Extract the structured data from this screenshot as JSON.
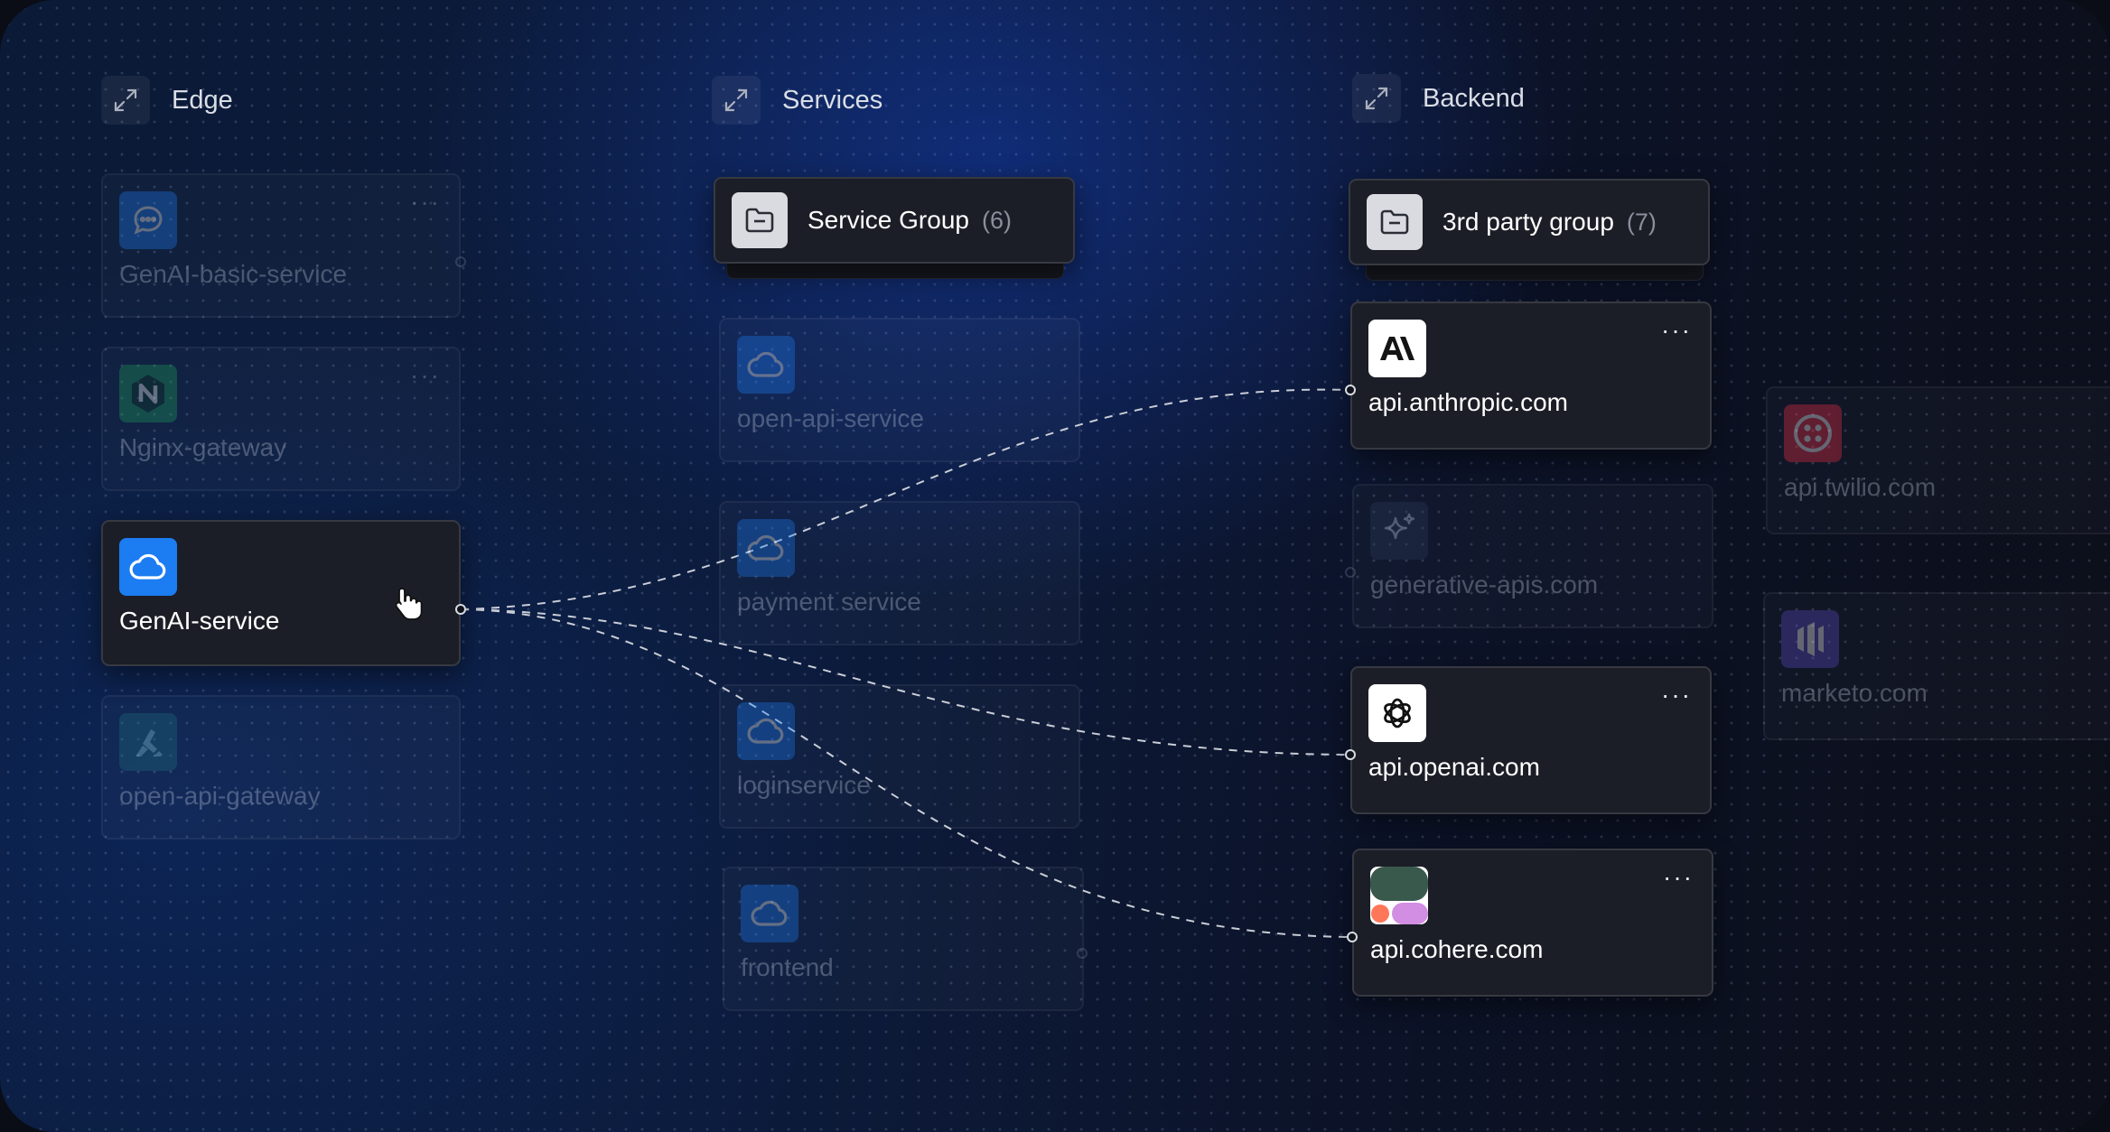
{
  "headers": {
    "edge": "Edge",
    "services": "Services",
    "backend": "Backend"
  },
  "edge": {
    "genai_basic": {
      "label": "GenAI-basic-service",
      "menu": "···",
      "icon": "chat-bubble-icon"
    },
    "nginx": {
      "label": "Nginx-gateway",
      "menu": "···",
      "icon": "nginx-icon"
    },
    "genai": {
      "label": "GenAI-service",
      "icon": "cloud-icon",
      "accent": "#1c7cf2"
    },
    "open_api_gateway": {
      "label": "open-api-gateway",
      "icon": "kong-icon"
    }
  },
  "services": {
    "group": {
      "name": "Service Group",
      "count": "(6)",
      "icon": "folder-icon"
    },
    "items": [
      {
        "label": "open-api-service",
        "icon": "cloud-icon"
      },
      {
        "label": "payment service",
        "icon": "cloud-icon"
      },
      {
        "label": "loginservice",
        "icon": "cloud-icon"
      },
      {
        "label": "frontend",
        "icon": "cloud-icon"
      }
    ]
  },
  "backend": {
    "group": {
      "name": "3rd party group",
      "count": "(7)",
      "icon": "folder-icon"
    },
    "anthropic": {
      "label": "api.anthropic.com",
      "menu": "···",
      "icon": "anthropic-icon"
    },
    "generative": {
      "label": "generative-apis.com",
      "icon": "sparkle-icon"
    },
    "openai": {
      "label": "api.openai.com",
      "menu": "···",
      "icon": "openai-icon"
    },
    "cohere": {
      "label": "api.cohere.com",
      "menu": "···",
      "icon": "cohere-icon"
    }
  },
  "external": {
    "twilio": {
      "label": "api.twilio.com",
      "menu": "···",
      "icon": "twilio-icon"
    },
    "marketo": {
      "label": "marketo.com",
      "menu": "···",
      "icon": "marketo-icon"
    }
  }
}
